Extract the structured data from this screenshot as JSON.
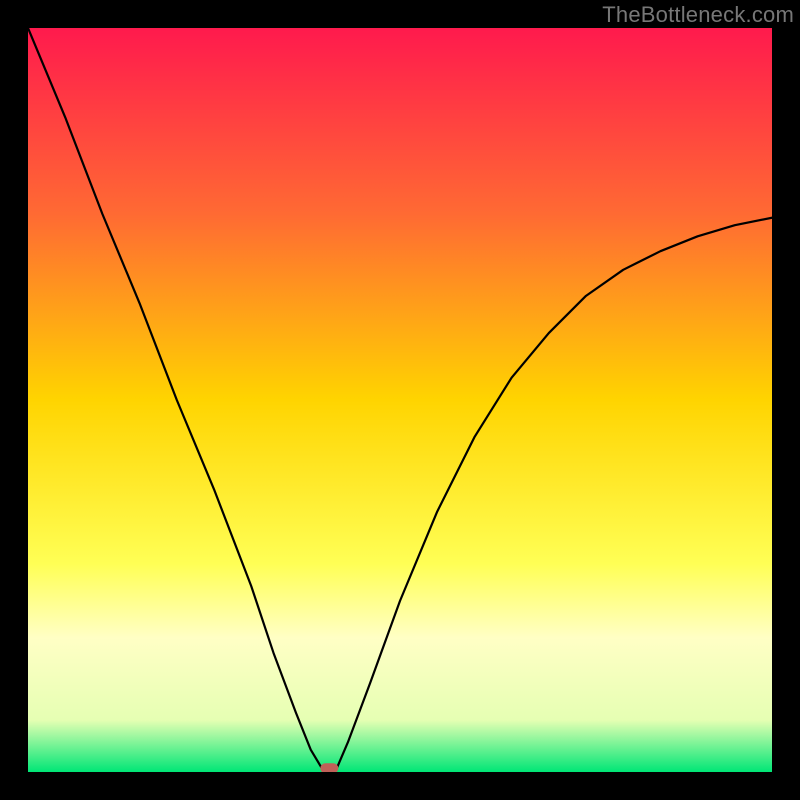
{
  "watermark": "TheBottleneck.com",
  "chart_data": {
    "type": "line",
    "title": "",
    "xlabel": "",
    "ylabel": "",
    "xlim": [
      0,
      100
    ],
    "ylim": [
      0,
      100
    ],
    "grid": false,
    "background_gradient": {
      "stops": [
        {
          "offset": 0,
          "color": "#ff1a4d"
        },
        {
          "offset": 25,
          "color": "#ff6a33"
        },
        {
          "offset": 50,
          "color": "#ffd400"
        },
        {
          "offset": 72,
          "color": "#ffff55"
        },
        {
          "offset": 82,
          "color": "#ffffc5"
        },
        {
          "offset": 93,
          "color": "#e6ffb3"
        },
        {
          "offset": 100,
          "color": "#00e676"
        }
      ]
    },
    "series": [
      {
        "name": "bottleneck-curve",
        "color": "#000000",
        "x": [
          0,
          5,
          10,
          15,
          20,
          25,
          30,
          33,
          36,
          38,
          39.5,
          40.5,
          41.5,
          43,
          46,
          50,
          55,
          60,
          65,
          70,
          75,
          80,
          85,
          90,
          95,
          100
        ],
        "values": [
          100,
          88,
          75,
          63,
          50,
          38,
          25,
          16,
          8,
          3,
          0.5,
          0,
          0.5,
          4,
          12,
          23,
          35,
          45,
          53,
          59,
          64,
          67.5,
          70,
          72,
          73.5,
          74.5
        ]
      }
    ],
    "marker": {
      "name": "optimal-point",
      "x": 40.5,
      "y": 0.5,
      "color": "#c06058",
      "shape": "rounded-rect"
    }
  }
}
